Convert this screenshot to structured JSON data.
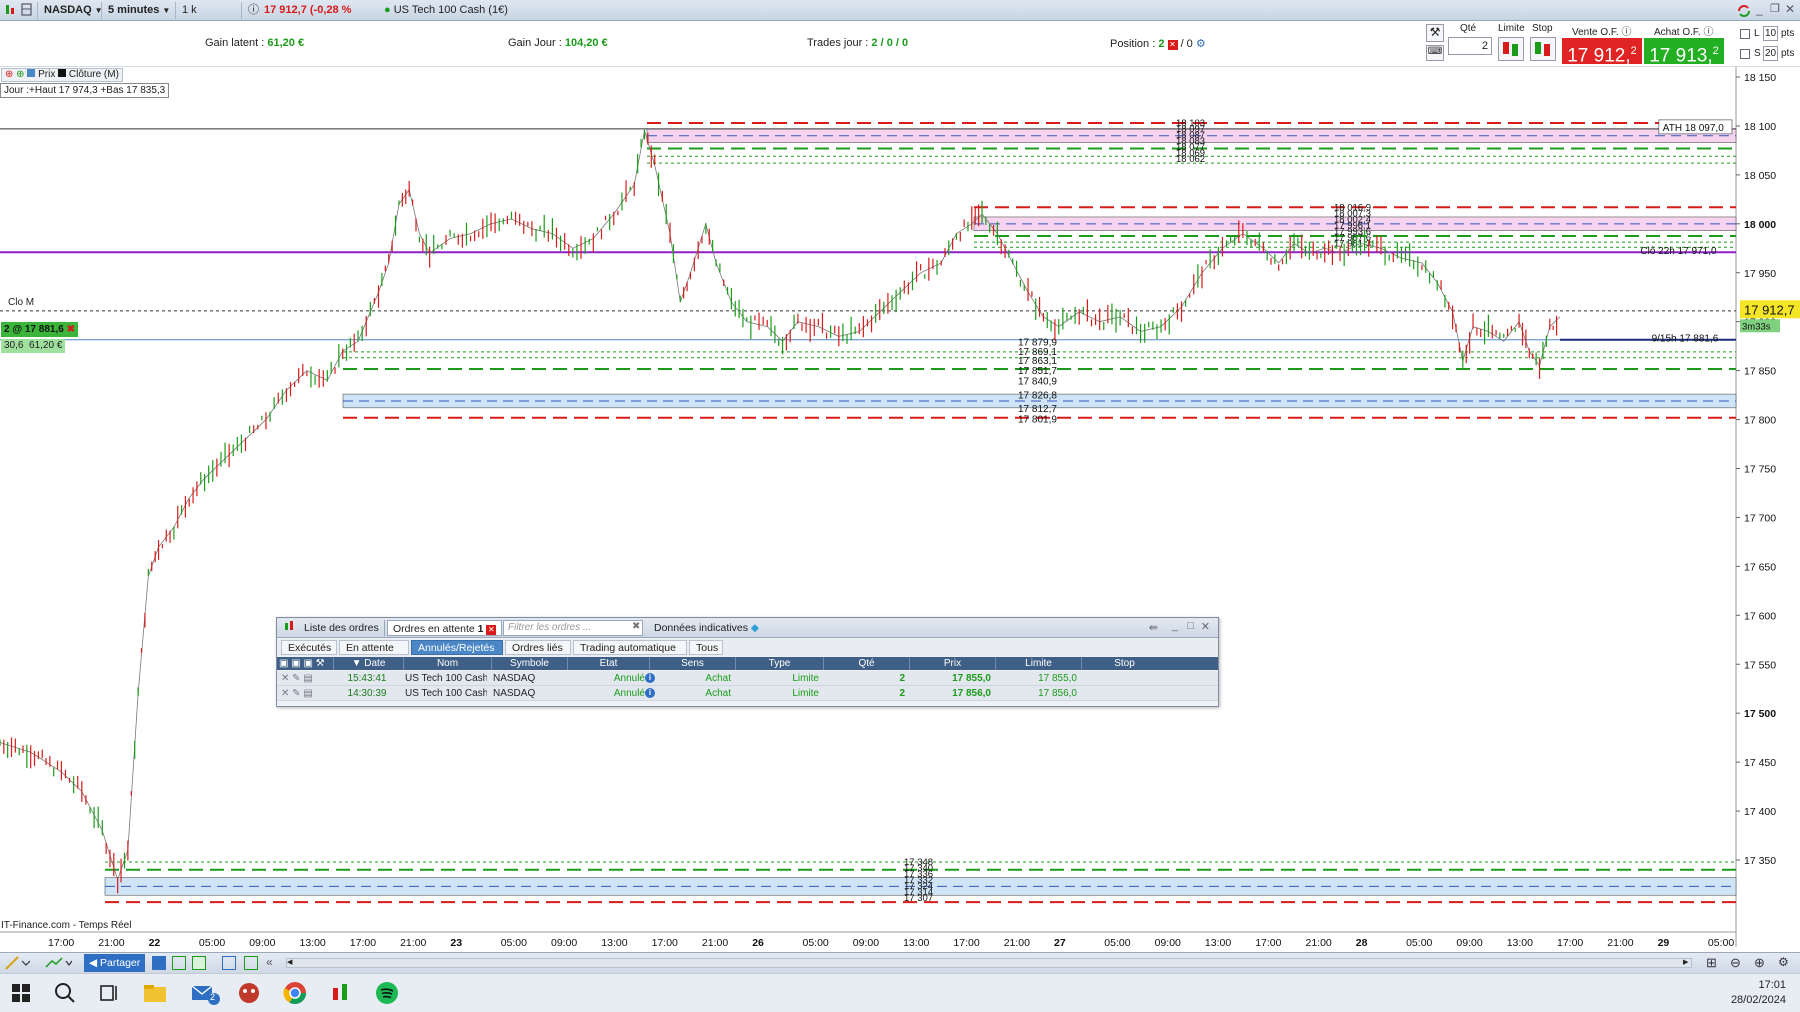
{
  "toolbar": {
    "instrument": "NASDAQ",
    "timeframe": "5 minutes",
    "units": "1 k unités",
    "quote": "17 912,7 (-0,28 % -50,1)",
    "product": "US Tech 100 Cash (1€)"
  },
  "stats": {
    "gain_latent_label": "Gain latent :",
    "gain_latent_value": "61,20 €",
    "gain_jour_label": "Gain Jour :",
    "gain_jour_value": "104,20 €",
    "trades_label": "Trades jour :",
    "trades_value": "2 / 0 / 0",
    "position_label": "Position :",
    "position_value": "2",
    "position_extra": "/ 0"
  },
  "trade_panel": {
    "qty_label": "Qté",
    "qty_value": "2",
    "limit_label": "Limite",
    "stop_label": "Stop",
    "sell_label": "Vente O.F.",
    "buy_label": "Achat O.F.",
    "sell_price": "17 912,",
    "sell_sup": "2",
    "buy_price": "17 913,",
    "buy_sup": "2",
    "l_label": "L",
    "l_value": "10",
    "s_label": "S",
    "s_value": "20",
    "pts": "pts"
  },
  "chart_header": {
    "legend_prix": "Prix",
    "legend_cloture": "Clôture (M)",
    "day_info": "Jour :+Haut 17 974,3 +Bas 17 835,3",
    "clo_m": "Clo M",
    "position_tag": "2 @ 17 881,6",
    "position_pts": "30,6",
    "position_gain": "61,20 €",
    "footer": "IT-Finance.com - Temps Réel"
  },
  "chart_data": {
    "type": "candlestick",
    "ylim": [
      17300,
      18150
    ],
    "y_ticks": [
      "18 150",
      "18 100",
      "18 050",
      "18 000",
      "17 950",
      "17 900",
      "17 850",
      "17 800",
      "17 750",
      "17 700",
      "17 650",
      "17 600",
      "17 550",
      "17 500",
      "17 450",
      "17 400",
      "17 350"
    ],
    "y_tick_values": [
      18150,
      18100,
      18050,
      18000,
      17950,
      17900,
      17850,
      17800,
      17750,
      17700,
      17650,
      17600,
      17550,
      17500,
      17450,
      17400,
      17350
    ],
    "x_ticks": [
      "17:00",
      "21:00",
      "22",
      "05:00",
      "09:00",
      "13:00",
      "17:00",
      "21:00",
      "23",
      "05:00",
      "09:00",
      "13:00",
      "17:00",
      "21:00",
      "26",
      "05:00",
      "09:00",
      "13:00",
      "17:00",
      "21:00",
      "27",
      "05:00",
      "09:00",
      "13:00",
      "17:00",
      "21:00",
      "28",
      "05:00",
      "09:00",
      "13:00",
      "17:00",
      "21:00",
      "29",
      "05:00"
    ],
    "x_tick_bold": [
      false,
      false,
      true,
      false,
      false,
      false,
      false,
      false,
      true,
      false,
      false,
      false,
      false,
      false,
      true,
      false,
      false,
      false,
      false,
      false,
      true,
      false,
      false,
      false,
      false,
      false,
      true,
      false,
      false,
      false,
      false,
      false,
      true,
      false
    ],
    "last_price": "17 912,7",
    "last_price_value": 17912.7,
    "countdown": "3m33s",
    "annotations": [
      {
        "label": "ATH 18 097,0",
        "value": 18097.0
      },
      {
        "label": "Clô 22h 17 971,0",
        "value": 17971.0
      },
      {
        "label": "9/15h 17 881,6",
        "value": 17881.6
      }
    ],
    "level_labels_upper": [
      "18 103",
      "18 097",
      "18 087",
      "18 083",
      "18 077",
      "18 069",
      "18 062"
    ],
    "level_labels_mid": [
      "18 016,9",
      "18 007,3",
      "18 002,4",
      "17 996,1",
      "17 993,6",
      "17 987,6",
      "17 981,3"
    ],
    "level_labels_lower": [
      "17 879,9",
      "17 869,1",
      "17 863,1",
      "17 851,7",
      "17 840,9",
      "17 826,8",
      "17 812,7",
      "17 801,9"
    ],
    "level_labels_bottom": [
      "17 348",
      "17 340",
      "17 336",
      "17 332",
      "17 324",
      "17 314",
      "17 307"
    ],
    "path_points": [
      [
        0,
        17470
      ],
      [
        12,
        17460
      ],
      [
        24,
        17440
      ],
      [
        32,
        17420
      ],
      [
        40,
        17380
      ],
      [
        46,
        17330
      ],
      [
        50,
        17360
      ],
      [
        54,
        17520
      ],
      [
        58,
        17640
      ],
      [
        62,
        17670
      ],
      [
        68,
        17690
      ],
      [
        74,
        17720
      ],
      [
        80,
        17740
      ],
      [
        88,
        17760
      ],
      [
        96,
        17780
      ],
      [
        104,
        17800
      ],
      [
        112,
        17830
      ],
      [
        120,
        17850
      ],
      [
        128,
        17840
      ],
      [
        134,
        17870
      ],
      [
        140,
        17880
      ],
      [
        148,
        17930
      ],
      [
        152,
        17960
      ],
      [
        156,
        18020
      ],
      [
        160,
        18035
      ],
      [
        164,
        17990
      ],
      [
        168,
        17970
      ],
      [
        176,
        17985
      ],
      [
        184,
        17990
      ],
      [
        192,
        18000
      ],
      [
        200,
        18005
      ],
      [
        208,
        17995
      ],
      [
        216,
        17990
      ],
      [
        224,
        17975
      ],
      [
        232,
        17985
      ],
      [
        240,
        18010
      ],
      [
        248,
        18040
      ],
      [
        252,
        18095
      ],
      [
        256,
        18060
      ],
      [
        262,
        17990
      ],
      [
        266,
        17920
      ],
      [
        270,
        17950
      ],
      [
        276,
        18000
      ],
      [
        280,
        17960
      ],
      [
        286,
        17920
      ],
      [
        292,
        17900
      ],
      [
        300,
        17895
      ],
      [
        306,
        17880
      ],
      [
        312,
        17900
      ],
      [
        320,
        17895
      ],
      [
        328,
        17885
      ],
      [
        336,
        17890
      ],
      [
        344,
        17910
      ],
      [
        352,
        17930
      ],
      [
        360,
        17950
      ],
      [
        368,
        17960
      ],
      [
        374,
        17990
      ],
      [
        380,
        18000
      ],
      [
        384,
        18010
      ],
      [
        390,
        17990
      ],
      [
        396,
        17960
      ],
      [
        402,
        17930
      ],
      [
        408,
        17905
      ],
      [
        414,
        17895
      ],
      [
        422,
        17910
      ],
      [
        430,
        17900
      ],
      [
        438,
        17905
      ],
      [
        446,
        17890
      ],
      [
        454,
        17895
      ],
      [
        462,
        17915
      ],
      [
        470,
        17950
      ],
      [
        478,
        17975
      ],
      [
        486,
        17990
      ],
      [
        494,
        17975
      ],
      [
        500,
        17960
      ],
      [
        506,
        17980
      ],
      [
        512,
        17970
      ],
      [
        518,
        17975
      ],
      [
        524,
        17970
      ],
      [
        532,
        17980
      ],
      [
        540,
        17975
      ],
      [
        548,
        17965
      ],
      [
        556,
        17960
      ],
      [
        562,
        17940
      ],
      [
        568,
        17910
      ],
      [
        572,
        17860
      ],
      [
        576,
        17895
      ],
      [
        582,
        17890
      ],
      [
        588,
        17880
      ],
      [
        594,
        17900
      ],
      [
        598,
        17870
      ],
      [
        602,
        17855
      ],
      [
        606,
        17895
      ],
      [
        610,
        17905
      ]
    ]
  },
  "order_window": {
    "tab_list": "Liste des ordres",
    "tab_pending": "Ordres en attente",
    "tab_pending_count": "1",
    "filter_placeholder": "Filtrer les ordres ...",
    "tab_data": "Données indicatives",
    "sub_tabs": [
      "Exécutés",
      "En attente",
      "Annulés/Rejetés",
      "Ordres liés",
      "Trading automatique",
      "Tous"
    ],
    "columns": [
      "Date",
      "Nom",
      "Symbole",
      "Etat",
      "Sens",
      "Type",
      "Qté",
      "Prix",
      "Limite",
      "Stop"
    ],
    "rows": [
      {
        "date": "15:43:41",
        "nom": "US Tech 100 Cash...",
        "symbole": "NASDAQ",
        "etat": "Annulé",
        "sens": "Achat",
        "type": "Limite",
        "qte": "2",
        "prix": "17 855,0",
        "limite": "17 855,0",
        "stop": ""
      },
      {
        "date": "14:30:39",
        "nom": "US Tech 100 Cash...",
        "symbole": "NASDAQ",
        "etat": "Annulé",
        "sens": "Achat",
        "type": "Limite",
        "qte": "2",
        "prix": "17 856,0",
        "limite": "17 856,0",
        "stop": ""
      }
    ]
  },
  "chart_tools": {
    "share_label": "Partager"
  },
  "taskbar": {
    "time": "17:01",
    "date": "28/02/2024",
    "mail_badge": "2"
  },
  "colors": {
    "up": "#1a9c1a",
    "down": "#d81a1a",
    "sell_button": "#e02323",
    "buy_button": "#22b022",
    "purple_line": "#8b21c9",
    "resistance_zone": "#f6d3ee",
    "support_zone": "#cfe5f7",
    "last_price_tag": "#f4e626"
  }
}
